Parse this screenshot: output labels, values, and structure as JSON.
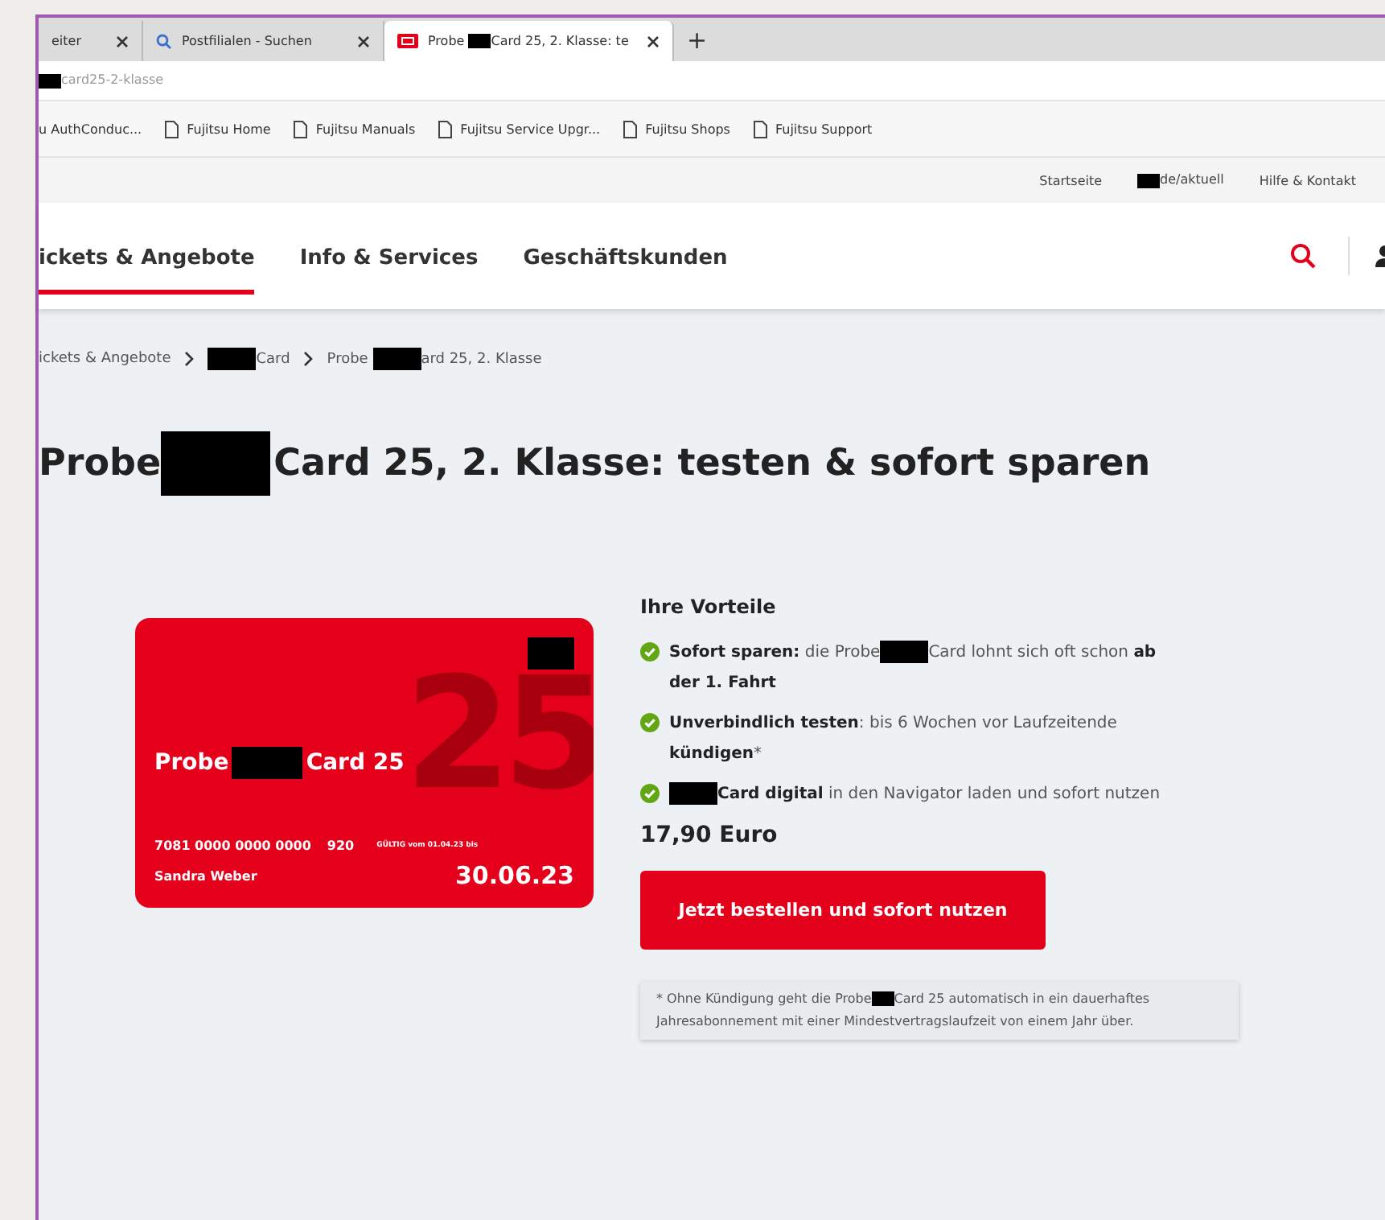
{
  "browser": {
    "tabs": [
      {
        "label": "eiter",
        "selected": false
      },
      {
        "label": "Postfilialen - Suchen",
        "selected": false
      },
      {
        "segments": [
          {
            "text": "Probe "
          },
          {
            "kind": "redaction"
          },
          {
            "text": "Card 25, 2. Klasse: te"
          }
        ],
        "selected": true
      }
    ],
    "new_tab": "+",
    "address": [
      {
        "kind": "redaction"
      },
      {
        "text": "card25-2-klasse"
      }
    ],
    "bookmarks": [
      "u AuthConduc...",
      "Fujitsu Home",
      "Fujitsu Manuals",
      "Fujitsu Service Upgr...",
      "Fujitsu Shops",
      "Fujitsu Support"
    ]
  },
  "top_links": [
    [
      {
        "text": "Startseite"
      }
    ],
    [
      {
        "kind": "redaction"
      },
      {
        "text": "de/aktuell"
      }
    ],
    [
      {
        "text": "Hilfe & Kontakt"
      }
    ]
  ],
  "nav": {
    "items": [
      {
        "label": "ickets & Angebote",
        "selected": true
      },
      {
        "label": "Info & Services",
        "selected": false
      },
      {
        "label": "Geschäftskunden",
        "selected": false
      }
    ]
  },
  "breadcrumb": [
    [
      {
        "text": "ickets & Angebote"
      }
    ],
    [
      {
        "kind": "redaction"
      },
      {
        "text": "Card"
      }
    ],
    [
      {
        "text": "Probe "
      },
      {
        "kind": "redaction"
      },
      {
        "text": "ard 25, 2. Klasse"
      }
    ]
  ],
  "title": [
    {
      "text": "Probe "
    },
    {
      "kind": "redaction"
    },
    {
      "text": "Card 25, 2. Klasse: testen & sofort sparen"
    }
  ],
  "card": {
    "name": [
      {
        "text": "Probe "
      },
      {
        "kind": "redaction"
      },
      {
        "text": "Card 25"
      }
    ],
    "big_number": "25",
    "number": "7081 0000 0000 0000",
    "code": "920",
    "validity": "GÜLTIG vom 01.04.23 bis",
    "holder": "Sandra Weber",
    "expiry": "30.06.23"
  },
  "benefits": {
    "heading": "Ihre Vorteile",
    "items": [
      [
        {
          "text": "**Sofort sparen:** die Probe"
        },
        {
          "kind": "redaction"
        },
        {
          "text": "Card lohnt sich oft schon **ab der 1. Fahrt**"
        }
      ],
      [
        {
          "text": "**Unverbindlich testen**: bis 6 Wochen vor Laufzeitende **kündigen***"
        }
      ],
      [
        {
          "kind": "redaction"
        },
        {
          "text": "**Card digital** in den Navigator laden und sofort nutzen"
        }
      ]
    ]
  },
  "price": "17,90 Euro",
  "order_button": "Jetzt bestellen und sofort nutzen",
  "footnote": [
    {
      "text": "* Ohne Kündigung geht die Probe"
    },
    {
      "kind": "redaction"
    },
    {
      "text": "Card 25 automatisch in ein dauerhaftes Jahresabonnement mit einer Mindestvertragslaufzeit von einem Jahr über."
    }
  ]
}
